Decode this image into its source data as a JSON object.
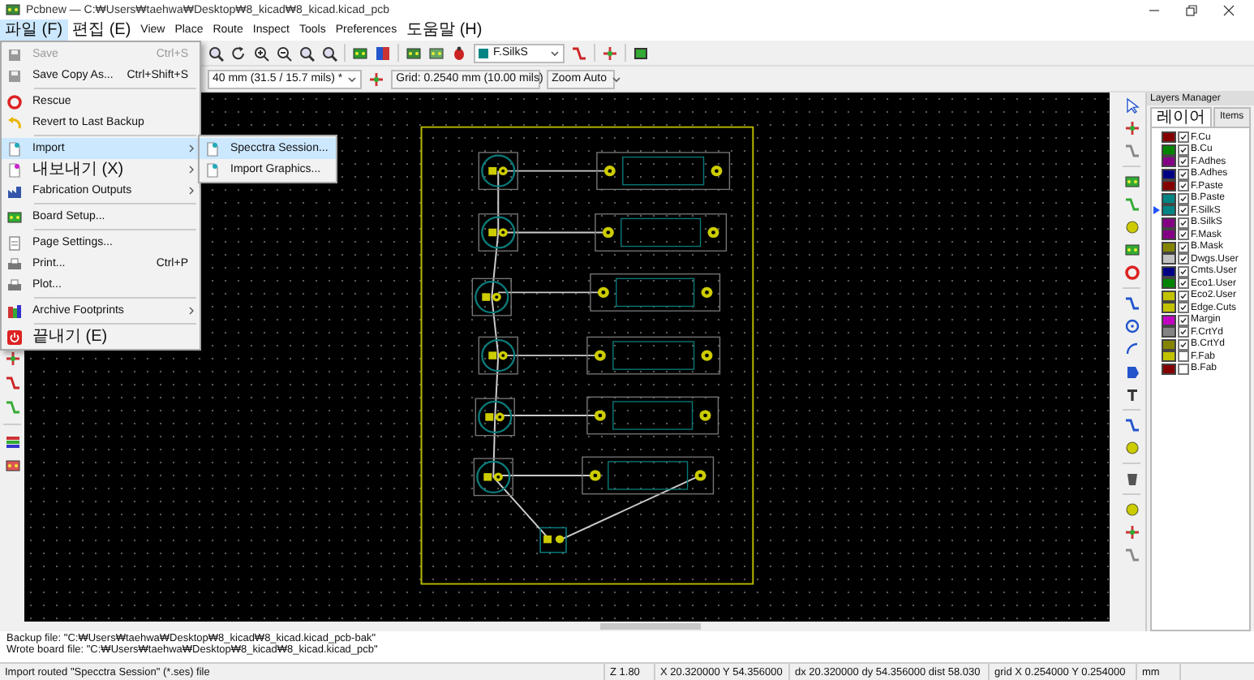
{
  "window": {
    "title": "Pcbnew — C:₩Users₩taehwa₩Desktop₩8_kicad₩8_kicad.kicad_pcb"
  },
  "menu_bar": [
    {
      "label": "파일 (F)",
      "selected": true
    },
    {
      "label": "편집 (E)",
      "selected": false
    },
    {
      "label": "View",
      "selected": false
    },
    {
      "label": "Place",
      "selected": false
    },
    {
      "label": "Route",
      "selected": false
    },
    {
      "label": "Inspect",
      "selected": false
    },
    {
      "label": "Tools",
      "selected": false
    },
    {
      "label": "Preferences",
      "selected": false
    },
    {
      "label": "도움말 (H)",
      "selected": false
    }
  ],
  "file_menu": {
    "items": [
      {
        "kind": "item",
        "label": "Save",
        "shortcut": "Ctrl+S",
        "disabled": true,
        "submenu": false,
        "selected": false
      },
      {
        "kind": "item",
        "label": "Save Copy As...",
        "shortcut": "Ctrl+Shift+S",
        "disabled": false,
        "submenu": false,
        "selected": false
      },
      {
        "kind": "separator"
      },
      {
        "kind": "item",
        "label": "Rescue",
        "disabled": false,
        "submenu": false,
        "selected": false
      },
      {
        "kind": "item",
        "label": "Revert to Last Backup",
        "disabled": false,
        "submenu": false,
        "selected": false
      },
      {
        "kind": "separator"
      },
      {
        "kind": "item",
        "label": "Import",
        "disabled": false,
        "submenu": true,
        "selected": true
      },
      {
        "kind": "item",
        "label": "내보내기 (X)",
        "disabled": false,
        "submenu": true,
        "selected": false
      },
      {
        "kind": "item",
        "label": "Fabrication Outputs",
        "disabled": false,
        "submenu": true,
        "selected": false
      },
      {
        "kind": "separator"
      },
      {
        "kind": "item",
        "label": "Board Setup...",
        "disabled": false,
        "submenu": false,
        "selected": false
      },
      {
        "kind": "separator"
      },
      {
        "kind": "item",
        "label": "Page Settings...",
        "disabled": false,
        "submenu": false,
        "selected": false
      },
      {
        "kind": "item",
        "label": "Print...",
        "shortcut": "Ctrl+P",
        "disabled": false,
        "submenu": false,
        "selected": false
      },
      {
        "kind": "item",
        "label": "Plot...",
        "disabled": false,
        "submenu": false,
        "selected": false
      },
      {
        "kind": "separator"
      },
      {
        "kind": "item",
        "label": "Archive Footprints",
        "disabled": false,
        "submenu": true,
        "selected": false
      },
      {
        "kind": "separator"
      },
      {
        "kind": "item",
        "label": "끝내기 (E)",
        "disabled": false,
        "submenu": false,
        "selected": false
      }
    ]
  },
  "import_submenu": {
    "items": [
      {
        "label": "Specctra Session...",
        "selected": true
      },
      {
        "label": "Import Graphics...",
        "selected": false
      }
    ]
  },
  "toolbar": {
    "layer_select": "F.SilkS"
  },
  "aux_toolbar": {
    "track_width": "40 mm (31.5 / 15.7 mils) *",
    "grid": "Grid: 0.2540 mm (10.00 mils)",
    "zoom": "Zoom Auto"
  },
  "layers_manager": {
    "title": "Layers Manager",
    "tabs": [
      {
        "label": "레이어",
        "selected": true
      },
      {
        "label": "Items",
        "selected": false
      }
    ],
    "layers": [
      {
        "name": "F.Cu",
        "color": "#840000",
        "visible": true,
        "selected": false
      },
      {
        "name": "B.Cu",
        "color": "#008400",
        "visible": true,
        "selected": false
      },
      {
        "name": "F.Adhes",
        "color": "#840084",
        "visible": true,
        "selected": false
      },
      {
        "name": "B.Adhes",
        "color": "#000084",
        "visible": true,
        "selected": false
      },
      {
        "name": "F.Paste",
        "color": "#840000",
        "visible": true,
        "selected": false
      },
      {
        "name": "B.Paste",
        "color": "#008484",
        "visible": true,
        "selected": false
      },
      {
        "name": "F.SilkS",
        "color": "#008484",
        "visible": true,
        "selected": true
      },
      {
        "name": "B.SilkS",
        "color": "#840084",
        "visible": true,
        "selected": false
      },
      {
        "name": "F.Mask",
        "color": "#840084",
        "visible": true,
        "selected": false
      },
      {
        "name": "B.Mask",
        "color": "#848400",
        "visible": true,
        "selected": false
      },
      {
        "name": "Dwgs.User",
        "color": "#c2c2c2",
        "visible": true,
        "selected": false
      },
      {
        "name": "Cmts.User",
        "color": "#000084",
        "visible": true,
        "selected": false
      },
      {
        "name": "Eco1.User",
        "color": "#008400",
        "visible": true,
        "selected": false
      },
      {
        "name": "Eco2.User",
        "color": "#c2c200",
        "visible": true,
        "selected": false
      },
      {
        "name": "Edge.Cuts",
        "color": "#c2c200",
        "visible": true,
        "selected": false
      },
      {
        "name": "Margin",
        "color": "#c200c2",
        "visible": true,
        "selected": false
      },
      {
        "name": "F.CrtYd",
        "color": "#848484",
        "visible": true,
        "selected": false
      },
      {
        "name": "B.CrtYd",
        "color": "#848400",
        "visible": true,
        "selected": false
      },
      {
        "name": "F.Fab",
        "color": "#c2c200",
        "visible": false,
        "selected": false
      },
      {
        "name": "B.Fab",
        "color": "#840000",
        "visible": false,
        "selected": false
      }
    ]
  },
  "messages": [
    "Backup file: \"C:₩Users₩taehwa₩Desktop₩8_kicad₩8_kicad.kicad_pcb-bak\"",
    "Wrote board file: \"C:₩Users₩taehwa₩Desktop₩8_kicad₩8_kicad.kicad_pcb\""
  ],
  "status_bar": {
    "hint": "Import routed \"Specctra Session\" (*.ses) file",
    "zoom": "Z 1.80",
    "cursor": "X 20.320000  Y 54.356000",
    "delta": "dx 20.320000  dy 54.356000  dist 58.030",
    "grid": "grid X 0.254000  Y 0.254000",
    "units": "mm"
  }
}
